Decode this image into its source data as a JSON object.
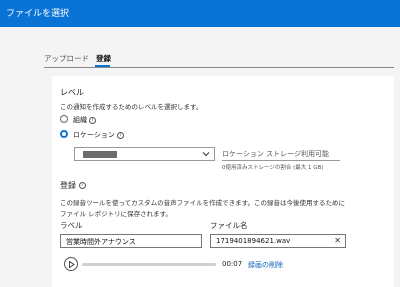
{
  "window": {
    "title": "ファイルを選択"
  },
  "tabs": [
    {
      "label": "アップロード",
      "selected": false
    },
    {
      "label": "登録",
      "selected": true
    }
  ],
  "level": {
    "title": "レベル",
    "description": "この通知を作成するためのレベルを選択します。",
    "options": [
      {
        "label": "組織",
        "info": "i",
        "checked": false
      },
      {
        "label": "ロケーション",
        "info": "i",
        "checked": true
      }
    ],
    "location_select": {
      "value": ""
    },
    "storage": {
      "title": "ロケーション ストレージ利用可能",
      "detail": "0使用済みストレージの割合 (最大 1 GB)"
    }
  },
  "record": {
    "title": "登録",
    "info": "i",
    "description_line1": "この録音ツールを使ってカスタムの音声ファイルを作成できます。この録音は今後使用するために",
    "description_line2": "ファイル レポジトリに保存されます。",
    "label_caption": "ラベル",
    "label_value": "営業時間外アナウンス",
    "filename_caption": "ファイル名",
    "filename_value": "1719401894621.wav",
    "clear_glyph": "✕",
    "player": {
      "time": "00:07",
      "progress": 0
    },
    "delete_label": "録画の削除"
  },
  "colors": {
    "accent": "#0a74d6",
    "link": "#0a5fb8"
  }
}
